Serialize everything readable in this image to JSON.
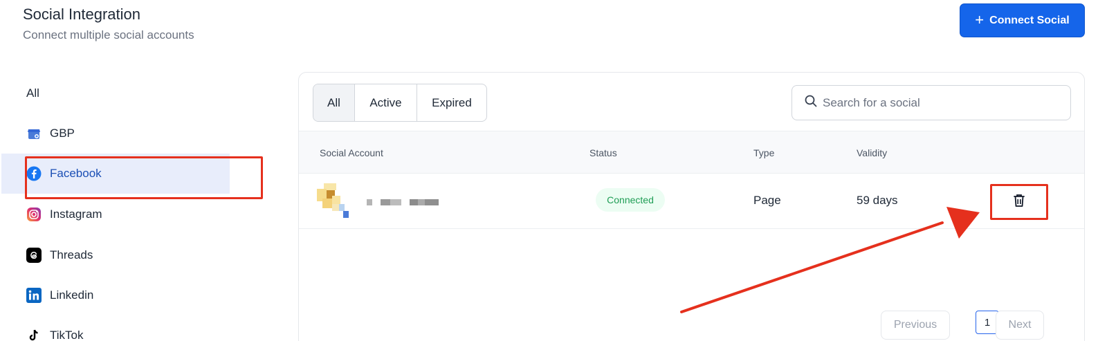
{
  "header": {
    "title": "Social Integration",
    "subtitle": "Connect multiple social accounts",
    "connect_button": {
      "icon": "plus-icon",
      "label": "Connect Social"
    }
  },
  "sidebar": {
    "items": [
      {
        "label": "All",
        "icon": ""
      },
      {
        "label": "GBP",
        "icon": "gbp-icon"
      },
      {
        "label": "Facebook",
        "icon": "facebook-icon",
        "selected": true
      },
      {
        "label": "Instagram",
        "icon": "instagram-icon"
      },
      {
        "label": "Threads",
        "icon": "threads-icon"
      },
      {
        "label": "Linkedin",
        "icon": "linkedin-icon"
      },
      {
        "label": "TikTok",
        "icon": "tiktok-icon"
      }
    ]
  },
  "filters": {
    "tabs": [
      "All",
      "Active",
      "Expired"
    ],
    "selected": "All"
  },
  "search": {
    "placeholder": "Search for a social",
    "icon": "search-icon"
  },
  "table": {
    "columns": [
      "Social Account",
      "Status",
      "Type",
      "Validity"
    ],
    "rows": [
      {
        "account": "",
        "status": "Connected",
        "type": "Page",
        "validity": "59 days",
        "action_icon": "trash-icon"
      }
    ]
  },
  "pagination": {
    "previous": "Previous",
    "page": "1",
    "next": "Next"
  },
  "colors": {
    "accent": "#1565ea",
    "annotation": "#e5301d",
    "status_connected": "#1f9d55"
  }
}
